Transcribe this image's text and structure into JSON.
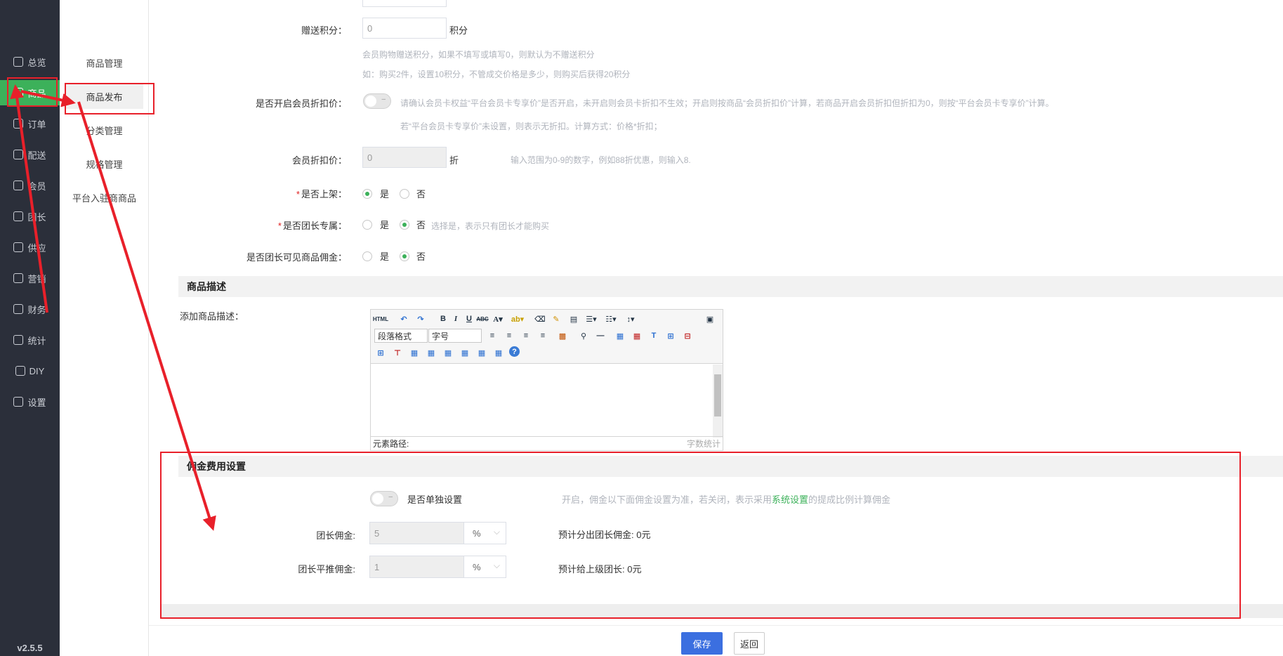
{
  "nav": {
    "items": [
      {
        "label": "总览",
        "icon": "home-icon"
      },
      {
        "label": "商品",
        "icon": "shop-icon",
        "active": true
      },
      {
        "label": "订单",
        "icon": "order-icon"
      },
      {
        "label": "配送",
        "icon": "delivery-icon"
      },
      {
        "label": "会员",
        "icon": "user-icon"
      },
      {
        "label": "团长",
        "icon": "leader-icon"
      },
      {
        "label": "供应",
        "icon": "store-icon"
      },
      {
        "label": "营销",
        "icon": "gift-icon"
      },
      {
        "label": "财务",
        "icon": "finance-icon"
      },
      {
        "label": "统计",
        "icon": "chart-icon"
      },
      {
        "label": "DIY",
        "icon": "layout-icon"
      },
      {
        "label": "设置",
        "icon": "gear-icon"
      }
    ],
    "version": "v2.5.5"
  },
  "subnav": {
    "items": [
      "商品管理",
      "商品发布",
      "分类管理",
      "规格管理",
      "平台入驻商商品"
    ],
    "active_index": 1
  },
  "form": {
    "points_label": "赠送积分：",
    "points_value": "0",
    "points_unit": "积分",
    "points_hint1": "会员购物赠送积分，如果不填写或填写0，则默认为不赠送积分",
    "points_hint2": "如：购买2件，设置10积分，不管成交价格是多少，则购买后获得20积分",
    "member_discount_label": "是否开启会员折扣价：",
    "member_discount_hint1": "请确认会员卡权益“平台会员卡专享价”是否开启，未开启则会员卡折扣不生效；开启则按商品“会员折扣价”计算，若商品开启会员折扣但折扣为0，则按“平台会员卡专享价”计算。",
    "member_discount_hint2": "若“平台会员卡专享价”未设置，则表示无折扣。计算方式：价格*折扣；",
    "discount_price_label": "会员折扣价：",
    "discount_price_value": "0",
    "discount_unit": "折",
    "discount_hint": "输入范围为0-9的数字，例如88折优惠，则输入8.",
    "on_shelf_label": "是否上架：",
    "leader_exclusive_label": "是否团长专属：",
    "leader_exclusive_hint": "选择是，表示只有团长才能购买",
    "leader_commission_visible_label": "是否团长可见商品佣金：",
    "yes": "是",
    "no": "否"
  },
  "description": {
    "section_title": "商品描述",
    "label": "添加商品描述：",
    "paragraph_format": "段落格式",
    "font_size": "字号",
    "element_path": "元素路径:",
    "word_count": "字数统计"
  },
  "commission": {
    "section_title": "佣金费用设置",
    "separate_label": "是否单独设置",
    "separate_hint_prefix": "开启，佣金以下面佣金设置为准，若关闭，表示采用",
    "separate_hint_link": "系统设置",
    "separate_hint_suffix": "的提成比例计算佣金",
    "leader_label": "团长佣金:",
    "leader_value": "5",
    "leader_unit": "%",
    "leader_estimate": "预计分出团长佣金: 0元",
    "referral_label": "团长平推佣金:",
    "referral_value": "1",
    "referral_unit": "%",
    "referral_estimate": "预计给上级团长: 0元"
  },
  "footer": {
    "save_label": "保存",
    "back_label": "返回"
  },
  "colors": {
    "accent": "#3cb15a",
    "primary_button": "#3b6fe0",
    "annotation_red": "#e8202a"
  }
}
